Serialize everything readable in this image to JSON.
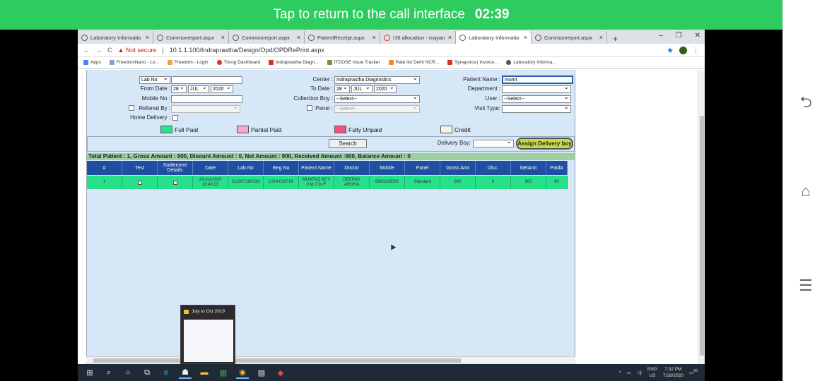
{
  "call_banner": {
    "text": "Tap to return to the call interface",
    "timer": "02:39"
  },
  "browser": {
    "tabs": [
      {
        "title": "Laboratory Informatio"
      },
      {
        "title": "Commonreport.aspx"
      },
      {
        "title": "Commonreport.aspx"
      },
      {
        "title": "PatientReceipt.aspx"
      },
      {
        "title": "I16 allocation - mayan"
      },
      {
        "title": "Laboratory Informatio"
      },
      {
        "title": "Commonreport.aspx"
      }
    ],
    "not_secure": "Not secure",
    "url": "10.1.1.100/Indraprastha/Design/Opd/OPDRePrint.aspx",
    "bookmarks": [
      "Apps",
      "FreedomNano - Lo...",
      "Freedom - Login",
      "Tricog Dashboard",
      "Indraprastha Diagn...",
      "ITDOSE Issue Tracker",
      "Rate list Delhi NCR...",
      "Synapsica | Invoice...",
      "Laboratory Informa..."
    ]
  },
  "form": {
    "lab_no_select": "Lab No",
    "from_date_label": "From Date :",
    "from_day": "28",
    "from_month": "JUL",
    "from_year": "2020",
    "mobile_label": "Mobile No :",
    "refered_by_label": "Refered By :",
    "home_delivery_label": "Home Delivery :",
    "center_label": "Center :",
    "center_value": "Indraprastha Diagnostics",
    "to_date_label": "To Date :",
    "to_day": "28",
    "to_month": "JUL",
    "to_year": "2020",
    "collection_boy_label": "Collection Boy :",
    "collection_boy_value": "--Select--",
    "panel_label": "Panel :",
    "panel_value": "--Select--",
    "refered_by_value": "",
    "patient_name_label": "Patient Name :",
    "patient_name_value": "mumt",
    "department_label": "Department :",
    "user_label": "User :",
    "user_value": "--Select--",
    "visit_type_label": "Visit Type:"
  },
  "legend": [
    {
      "label": "Full Paid",
      "color": "#22e58e"
    },
    {
      "label": "Partial Paid",
      "color": "#f3a8cc"
    },
    {
      "label": "Fully Unpaid",
      "color": "#f2527e"
    },
    {
      "label": "Credit",
      "color": "#f5f5e8"
    }
  ],
  "actions": {
    "search": "Search",
    "delivery_boy_label": "Delivery Boy:",
    "assign": "Assign Delivery boy"
  },
  "summary": "Total Patient : 1, Gross Amount : 900, Disount Amount : 0, Net Amount : 900, Received Amount :900, Balance Amount : 0",
  "table": {
    "headers": [
      "#",
      "Test",
      "Sattlement\nDetails",
      "Date",
      "Lab No",
      "Reg No",
      "Patient Name",
      "Doctor",
      "Mobile",
      "Panel",
      "Gross Amt",
      "Disc.",
      "NetAmt",
      "PaidA"
    ],
    "rows": [
      [
        "1",
        "",
        "",
        "28-Jul-2020\n16:49:23",
        "012007280036",
        "LSHHI36716",
        "MUMTAZ 62 Y\n0 M 0 D /F",
        "DEEPAK\nARORA",
        "9990208092",
        "Standard",
        "900",
        "0",
        "900",
        "90"
      ]
    ]
  },
  "thumbnail_popup": {
    "title": "July to Oct 2019"
  },
  "tray": {
    "lang": "ENG",
    "region": "US",
    "time": "7:32 PM",
    "date": "7/28/2020",
    "notif": "20"
  }
}
